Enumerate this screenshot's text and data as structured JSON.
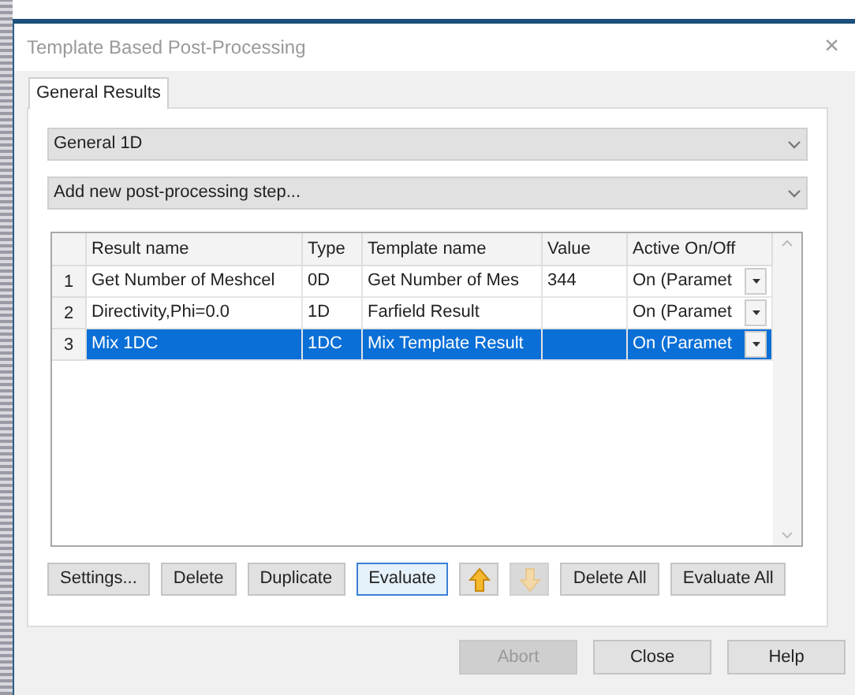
{
  "window": {
    "title": "Template Based Post-Processing",
    "close": "×"
  },
  "tabs": [
    {
      "label": "General Results",
      "selected": true
    }
  ],
  "combos": [
    {
      "value": "General 1D"
    },
    {
      "value": "Add new post-processing step..."
    }
  ],
  "table": {
    "columns": [
      "Result name",
      "Type",
      "Template name",
      "Value",
      "Active On/Off"
    ],
    "rows": [
      {
        "index": "1",
        "cells": [
          "Get Number of Meshcel",
          "0D",
          "Get Number of Mes",
          "344",
          "On (Paramet"
        ],
        "selected": false
      },
      {
        "index": "2",
        "cells": [
          "Directivity,Phi=0.0",
          "1D",
          "Farfield Result",
          "",
          "On (Paramet"
        ],
        "selected": false
      },
      {
        "index": "3",
        "cells": [
          "Mix 1DC",
          "1DC",
          "Mix Template Result",
          "",
          "On (Paramet"
        ],
        "selected": true
      }
    ]
  },
  "actions": [
    {
      "kind": "text",
      "label": "Settings...",
      "focused": false,
      "disabled": false
    },
    {
      "kind": "text",
      "label": "Delete",
      "focused": false,
      "disabled": false
    },
    {
      "kind": "text",
      "label": "Duplicate",
      "focused": false,
      "disabled": false
    },
    {
      "kind": "text",
      "label": "Evaluate",
      "focused": true,
      "disabled": false
    },
    {
      "kind": "up",
      "focused": false,
      "disabled": false
    },
    {
      "kind": "down",
      "focused": false,
      "disabled": true
    },
    {
      "kind": "text",
      "label": "Delete All",
      "focused": false,
      "disabled": false
    },
    {
      "kind": "text",
      "label": "Evaluate All",
      "focused": false,
      "disabled": false
    }
  ],
  "buttons": [
    {
      "label": "Abort",
      "disabled": true
    },
    {
      "label": "Close",
      "disabled": false
    },
    {
      "label": "Help",
      "disabled": false
    }
  ]
}
